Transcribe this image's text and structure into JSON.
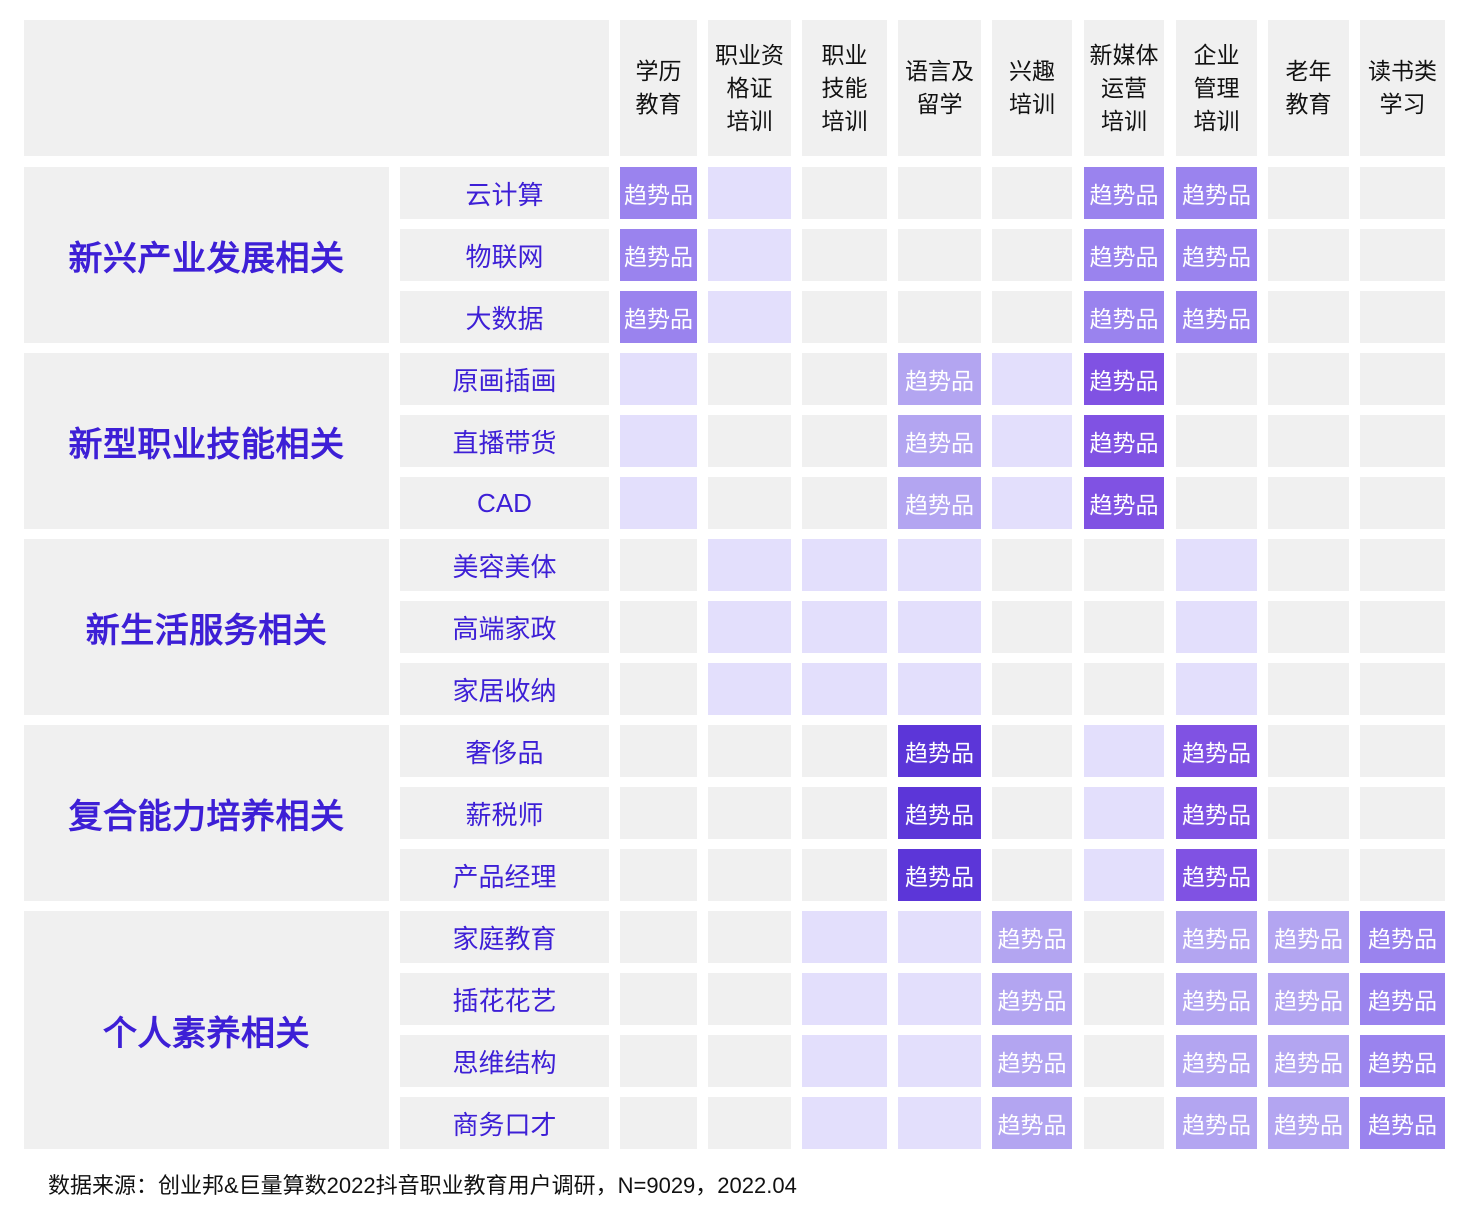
{
  "colors": {
    "cell_empty": "#f0f0f0",
    "level_1": "#e3dffc",
    "level_2": "#b3a5f1",
    "level_3": "#9a83ee",
    "level_4": "#8052e3",
    "level_5": "#5c36d8",
    "label_text": "#3d1fd6"
  },
  "chart_data": {
    "type": "heatmap",
    "mark_label": "趋势品",
    "columns": [
      "学历\n教育",
      "职业资\n格证\n培训",
      "职业\n技能\n培训",
      "语言及\n留学",
      "兴趣\n培训",
      "新媒体\n运营\n培训",
      "企业\n管理\n培训",
      "老年\n教育",
      "读书类\n学习"
    ],
    "groups": [
      {
        "name": "新兴产业发展相关",
        "rows": [
          "云计算",
          "物联网",
          "大数据"
        ]
      },
      {
        "name": "新型职业技能相关",
        "rows": [
          "原画插画",
          "直播带货",
          "CAD"
        ]
      },
      {
        "name": "新生活服务相关",
        "rows": [
          "美容美体",
          "高端家政",
          "家居收纳"
        ]
      },
      {
        "name": "复合能力培养相关",
        "rows": [
          "奢侈品",
          "薪税师",
          "产品经理"
        ]
      },
      {
        "name": "个人素养相关",
        "rows": [
          "家庭教育",
          "插花花艺",
          "思维结构",
          "商务口才"
        ]
      }
    ],
    "level_scale": "0 = grey (none), 1 = pale lavender, 2–5 = purple shades (light to dark); cells at level 2+ carry the 趋势品 label",
    "levels": [
      [
        3,
        1,
        0,
        0,
        0,
        3,
        3,
        0,
        0
      ],
      [
        3,
        1,
        0,
        0,
        0,
        3,
        3,
        0,
        0
      ],
      [
        3,
        1,
        0,
        0,
        0,
        3,
        3,
        0,
        0
      ],
      [
        1,
        0,
        0,
        2,
        1,
        4,
        0,
        0,
        0
      ],
      [
        1,
        0,
        0,
        2,
        1,
        4,
        0,
        0,
        0
      ],
      [
        1,
        0,
        0,
        2,
        1,
        4,
        0,
        0,
        0
      ],
      [
        0,
        1,
        1,
        1,
        0,
        0,
        1,
        0,
        0
      ],
      [
        0,
        1,
        1,
        1,
        0,
        0,
        1,
        0,
        0
      ],
      [
        0,
        1,
        1,
        1,
        0,
        0,
        1,
        0,
        0
      ],
      [
        0,
        0,
        0,
        5,
        0,
        1,
        4,
        0,
        0
      ],
      [
        0,
        0,
        0,
        5,
        0,
        1,
        4,
        0,
        0
      ],
      [
        0,
        0,
        0,
        5,
        0,
        1,
        4,
        0,
        0
      ],
      [
        0,
        0,
        1,
        1,
        2,
        0,
        2,
        2,
        3
      ],
      [
        0,
        0,
        1,
        1,
        2,
        0,
        2,
        2,
        3
      ],
      [
        0,
        0,
        1,
        1,
        2,
        0,
        2,
        2,
        3
      ],
      [
        0,
        0,
        1,
        1,
        2,
        0,
        2,
        2,
        3
      ]
    ]
  },
  "footer": {
    "source": "数据来源：创业邦&巨量算数2022抖音职业教育用户调研，N=9029，2022.04"
  }
}
